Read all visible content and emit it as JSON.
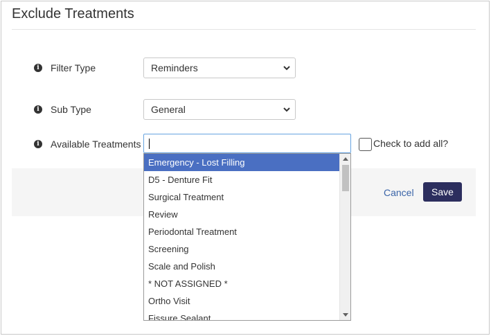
{
  "header": {
    "title": "Exclude Treatments"
  },
  "form": {
    "filter_type": {
      "label": "Filter Type",
      "value": "Reminders"
    },
    "sub_type": {
      "label": "Sub Type",
      "value": "General"
    },
    "available_treatments": {
      "label": "Available Treatments",
      "value": "",
      "check_all_label": "Check to add all?"
    }
  },
  "dropdown": {
    "selected_index": 0,
    "items": [
      "Emergency - Lost Filling",
      "D5 - Denture Fit",
      "Surgical Treatment",
      "Review",
      "Periodontal Treatment",
      "Screening",
      "Scale and Polish",
      "* NOT ASSIGNED *",
      "Ortho Visit",
      "Fissure Sealant"
    ]
  },
  "footer": {
    "cancel_label": "Cancel",
    "save_label": "Save"
  },
  "colors": {
    "accent": "#2c2e5e",
    "highlight": "#4a6fc2",
    "link": "#3a64a8"
  },
  "icons": {
    "info": "info-icon",
    "chevron": "chevron-down-icon"
  }
}
